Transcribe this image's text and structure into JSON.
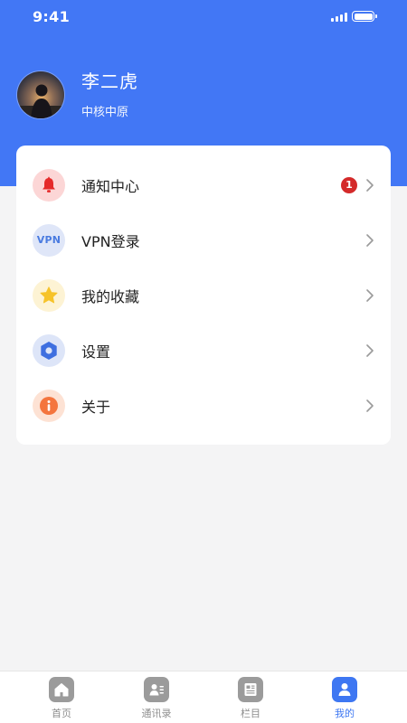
{
  "status_bar": {
    "time": "9:41"
  },
  "profile": {
    "name": "李二虎",
    "org": "中核中原"
  },
  "menu": [
    {
      "label": "通知中心",
      "icon": "bell-icon",
      "badge": "1",
      "icon_bg": "#fcd6d6"
    },
    {
      "label": "VPN登录",
      "icon": "vpn-icon",
      "icon_text": "VPN",
      "icon_bg": "#dfe6f8"
    },
    {
      "label": "我的收藏",
      "icon": "star-icon",
      "icon_bg": "#fdf3d4"
    },
    {
      "label": "设置",
      "icon": "hexagon-settings-icon",
      "icon_bg": "#dde5f8"
    },
    {
      "label": "关于",
      "icon": "info-icon",
      "icon_bg": "#fde2d4"
    }
  ],
  "tabbar": [
    {
      "label": "首页",
      "icon": "home-icon",
      "active": false
    },
    {
      "label": "通讯录",
      "icon": "contacts-icon",
      "active": false
    },
    {
      "label": "栏目",
      "icon": "columns-icon",
      "active": false
    },
    {
      "label": "我的",
      "icon": "profile-icon",
      "active": true
    }
  ],
  "colors": {
    "primary": "#4277f5",
    "badge": "#d42a2a",
    "tab_active": "#3e77f2",
    "tab_inactive": "#9b9b9b"
  }
}
